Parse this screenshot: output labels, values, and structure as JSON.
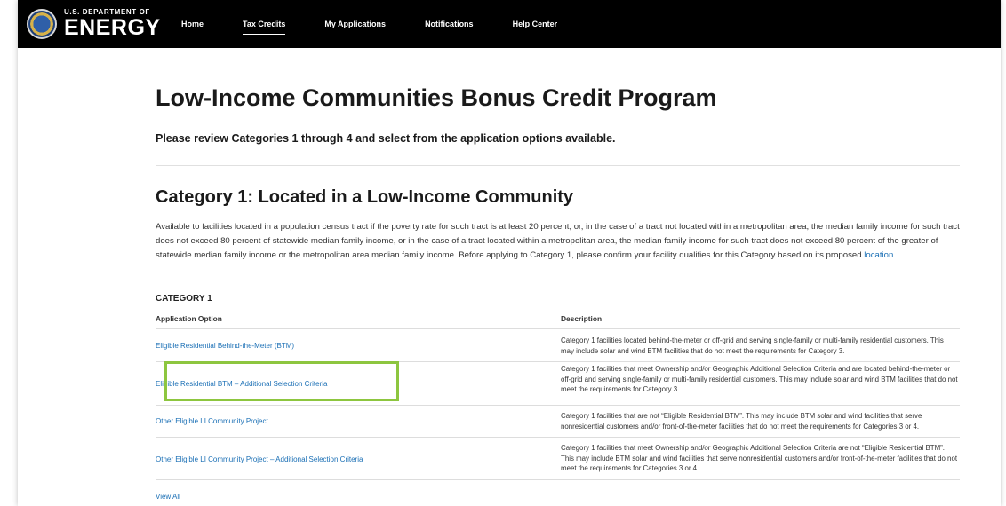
{
  "header": {
    "logo_small": "U.S. DEPARTMENT OF",
    "logo_big": "ENERGY",
    "nav": [
      "Home",
      "Tax Credits",
      "My Applications",
      "Notifications",
      "Help Center"
    ],
    "active_nav": "Tax Credits"
  },
  "page": {
    "title": "Low-Income Communities Bonus Credit Program",
    "intro": "Please review Categories 1 through 4 and select from the application options available."
  },
  "category": {
    "title": "Category 1: Located in a Low-Income Community",
    "description": "Available to facilities located in a population census tract if the poverty rate for such tract is at least 20 percent, or, in the case of a tract not located within a metropolitan area, the median family income for such tract does not exceed 80 percent of statewide median family income, or in the case of a tract located within a metropolitan area, the median family income for such tract does not exceed 80 percent of the greater of statewide median family income or the metropolitan area median family income. Before applying to Category 1, please confirm your facility qualifies for this Category based on its proposed",
    "description_link": "location",
    "description_end": ".",
    "label": "CATEGORY 1",
    "col_option": "Application Option",
    "col_description": "Description",
    "rows": [
      {
        "option": "Eligible Residential Behind-the-Meter (BTM)",
        "description": "Category 1 facilities located behind-the-meter or off-grid and serving single-family or multi-family residential customers. This may include solar and wind BTM facilities that do not meet the requirements for Category 3."
      },
      {
        "option": "Eligible Residential BTM – Additional Selection Criteria",
        "description": "Category 1 facilities that meet Ownership and/or Geographic Additional Selection Criteria and are located behind-the-meter or off-grid and serving single-family or multi-family residential customers. This may include solar and wind BTM facilities that do not meet the requirements for Category 3."
      },
      {
        "option": "Other Eligible LI Community Project",
        "description": "Category 1 facilities that are not “Eligible Residential BTM”. This may include BTM solar and wind facilities that serve nonresidential customers and/or front-of-the-meter facilities that do not meet the requirements for Categories 3 or 4."
      },
      {
        "option": "Other Eligible LI Community Project – Additional Selection Criteria",
        "description": "Category 1 facilities that meet Ownership and/or Geographic Additional Selection Criteria are not “Eligible Residential BTM”. This may include BTM solar and wind facilities that serve nonresidential customers and/or front-of-the-meter facilities that do not meet the requirements for Categories 3 or 4."
      }
    ],
    "view_all": "View All"
  },
  "colors": {
    "topbar": "#000000",
    "link": "#1a6fb5",
    "highlight": "#8dc63f"
  }
}
